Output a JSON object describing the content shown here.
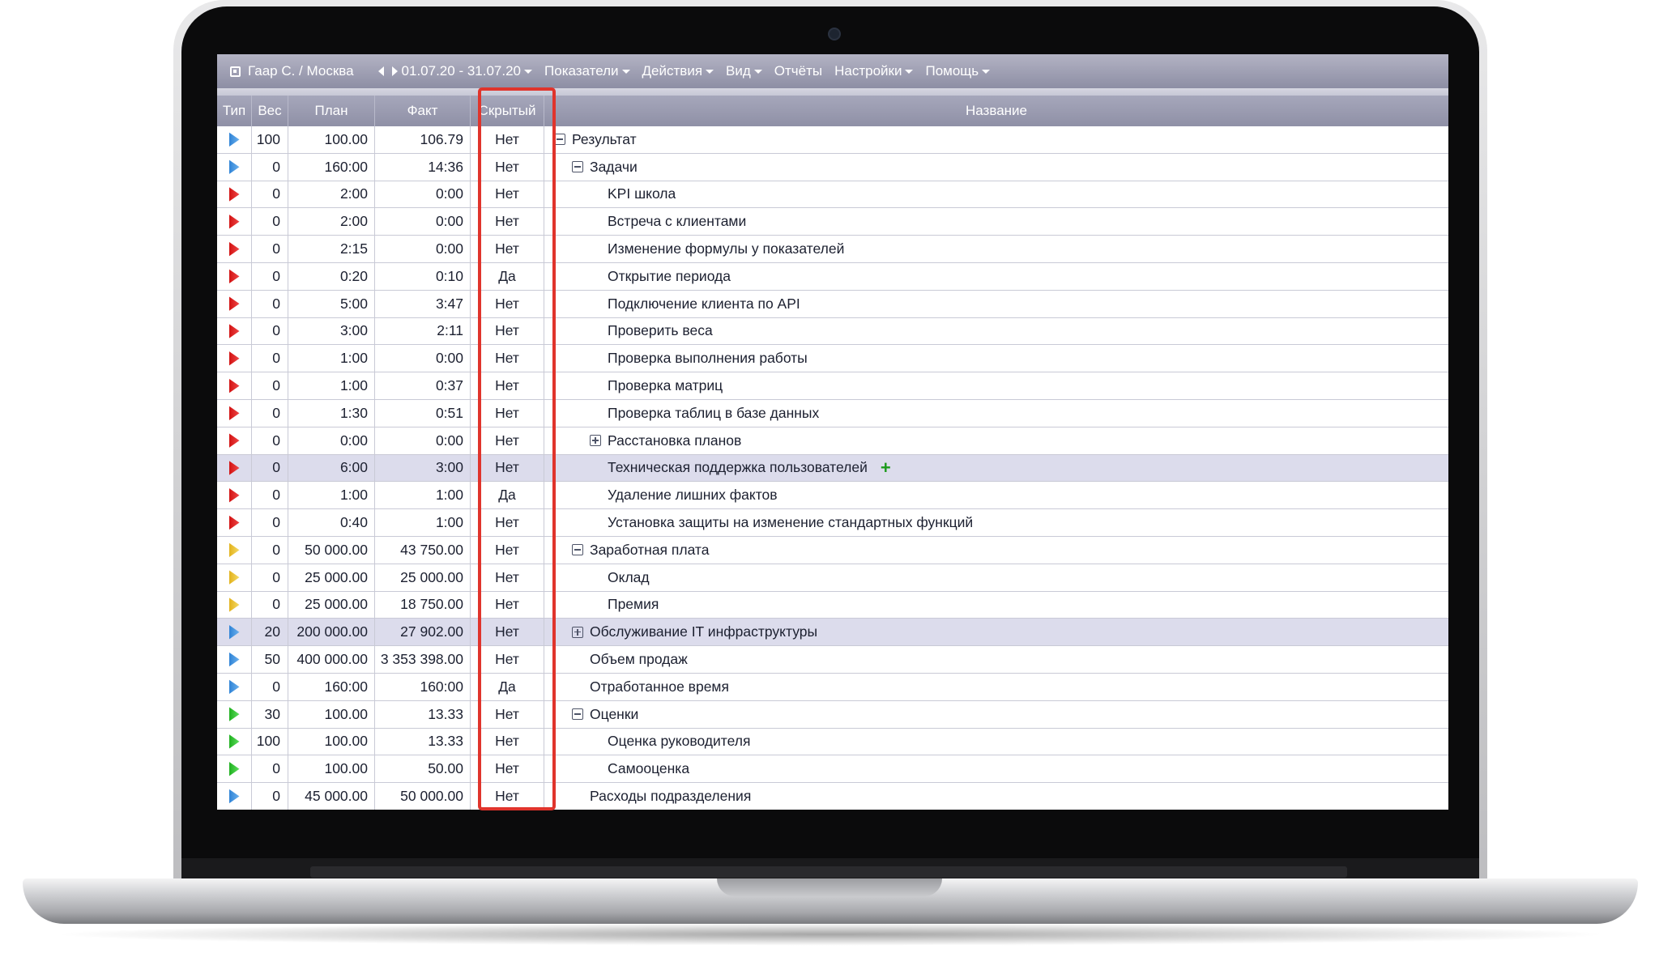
{
  "toolbar": {
    "user": "Гаар С. / Москва",
    "period": "01.07.20 - 31.07.20",
    "menu": [
      "Показатели",
      "Действия",
      "Вид",
      "Отчёты",
      "Настройки",
      "Помощь"
    ]
  },
  "table": {
    "headers": {
      "type": "Тип",
      "weight": "Вес",
      "plan": "План",
      "fact": "Факт",
      "hidden": "Скрытый",
      "name": "Название"
    },
    "rows": [
      {
        "type": "blue",
        "weight": "100",
        "plan": "100.00",
        "fact": "106.79",
        "hidden": "Нет",
        "name": "Результат",
        "level": 0,
        "toggle": "minus"
      },
      {
        "type": "blue",
        "weight": "0",
        "plan": "160:00",
        "fact": "14:36",
        "hidden": "Нет",
        "name": "Задачи",
        "level": 1,
        "toggle": "minus"
      },
      {
        "type": "red",
        "weight": "0",
        "plan": "2:00",
        "fact": "0:00",
        "hidden": "Нет",
        "name": "KPI школа",
        "level": 2,
        "toggle": "none"
      },
      {
        "type": "red",
        "weight": "0",
        "plan": "2:00",
        "fact": "0:00",
        "hidden": "Нет",
        "name": "Встреча с клиентами",
        "level": 2,
        "toggle": "none"
      },
      {
        "type": "red",
        "weight": "0",
        "plan": "2:15",
        "fact": "0:00",
        "hidden": "Нет",
        "name": "Изменение формулы у показателей",
        "level": 2,
        "toggle": "none"
      },
      {
        "type": "red",
        "weight": "0",
        "plan": "0:20",
        "fact": "0:10",
        "hidden": "Да",
        "name": "Открытие периода",
        "level": 2,
        "toggle": "none"
      },
      {
        "type": "red",
        "weight": "0",
        "plan": "5:00",
        "fact": "3:47",
        "hidden": "Нет",
        "name": "Подключение клиента по API",
        "level": 2,
        "toggle": "none"
      },
      {
        "type": "red",
        "weight": "0",
        "plan": "3:00",
        "fact": "2:11",
        "hidden": "Нет",
        "name": "Проверить веса",
        "level": 2,
        "toggle": "none"
      },
      {
        "type": "red",
        "weight": "0",
        "plan": "1:00",
        "fact": "0:00",
        "hidden": "Нет",
        "name": "Проверка выполнения работы",
        "level": 2,
        "toggle": "none"
      },
      {
        "type": "red",
        "weight": "0",
        "plan": "1:00",
        "fact": "0:37",
        "hidden": "Нет",
        "name": "Проверка матриц",
        "level": 2,
        "toggle": "none"
      },
      {
        "type": "red",
        "weight": "0",
        "plan": "1:30",
        "fact": "0:51",
        "hidden": "Нет",
        "name": "Проверка таблиц в базе данных",
        "level": 2,
        "toggle": "none"
      },
      {
        "type": "red",
        "weight": "0",
        "plan": "0:00",
        "fact": "0:00",
        "hidden": "Нет",
        "name": "Расстановка планов",
        "level": 2,
        "toggle": "plus"
      },
      {
        "type": "red",
        "weight": "0",
        "plan": "6:00",
        "fact": "3:00",
        "hidden": "Нет",
        "name": "Техническая поддержка пользователей",
        "level": 2,
        "toggle": "none",
        "selected": true,
        "add": "+"
      },
      {
        "type": "red",
        "weight": "0",
        "plan": "1:00",
        "fact": "1:00",
        "hidden": "Да",
        "name": "Удаление лишних фактов",
        "level": 2,
        "toggle": "none"
      },
      {
        "type": "red",
        "weight": "0",
        "plan": "0:40",
        "fact": "1:00",
        "hidden": "Нет",
        "name": "Установка защиты на изменение стандартных функций",
        "level": 2,
        "toggle": "none"
      },
      {
        "type": "yellow",
        "weight": "0",
        "plan": "50 000.00",
        "fact": "43 750.00",
        "hidden": "Нет",
        "name": "Заработная плата",
        "level": 1,
        "toggle": "minus"
      },
      {
        "type": "yellow",
        "weight": "0",
        "plan": "25 000.00",
        "fact": "25 000.00",
        "hidden": "Нет",
        "name": "Оклад",
        "level": 2,
        "toggle": "none"
      },
      {
        "type": "yellow",
        "weight": "0",
        "plan": "25 000.00",
        "fact": "18 750.00",
        "hidden": "Нет",
        "name": "Премия",
        "level": 2,
        "toggle": "none"
      },
      {
        "type": "blue",
        "weight": "20",
        "plan": "200 000.00",
        "fact": "27 902.00",
        "hidden": "Нет",
        "name": "Обслуживание IT инфраструктуры",
        "level": 1,
        "toggle": "plus",
        "selected": true
      },
      {
        "type": "blue",
        "weight": "50",
        "plan": "400 000.00",
        "fact": "3 353 398.00",
        "hidden": "Нет",
        "name": "Объем продаж",
        "level": 1,
        "toggle": "none"
      },
      {
        "type": "blue",
        "weight": "0",
        "plan": "160:00",
        "fact": "160:00",
        "hidden": "Да",
        "name": "Отработанное время",
        "level": 1,
        "toggle": "none"
      },
      {
        "type": "green",
        "weight": "30",
        "plan": "100.00",
        "fact": "13.33",
        "hidden": "Нет",
        "name": "Оценки",
        "level": 1,
        "toggle": "minus"
      },
      {
        "type": "green",
        "weight": "100",
        "plan": "100.00",
        "fact": "13.33",
        "hidden": "Нет",
        "name": "Оценка руководителя",
        "level": 2,
        "toggle": "none"
      },
      {
        "type": "green",
        "weight": "0",
        "plan": "100.00",
        "fact": "50.00",
        "hidden": "Нет",
        "name": "Самооценка",
        "level": 2,
        "toggle": "none"
      },
      {
        "type": "blue",
        "weight": "0",
        "plan": "45 000.00",
        "fact": "50 000.00",
        "hidden": "Нет",
        "name": "Расходы подразделения",
        "level": 1,
        "toggle": "none"
      }
    ]
  },
  "colors": {
    "highlight": "#e0342c",
    "accent": "#9697ad",
    "add_icon": "#1c9a1c"
  }
}
